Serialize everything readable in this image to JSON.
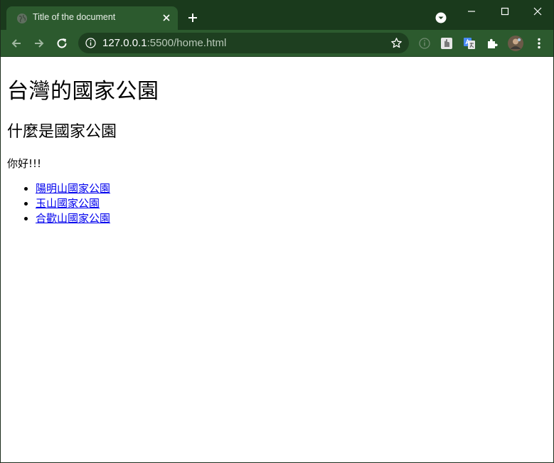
{
  "browser": {
    "tab": {
      "title": "Title of the document"
    },
    "address_bar": {
      "host": "127.0.0.1",
      "rest": ":5500/home.html"
    },
    "colors": {
      "frame": "#1a3a1c",
      "toolbar": "#2c5a2e",
      "omnibox": "#1e3f20",
      "link": "#0000ee"
    },
    "icons": {
      "tab_favicon": "globe-icon",
      "tab_close": "close-icon",
      "new_tab": "plus-icon",
      "tab_search": "chevron-down-circle-icon",
      "back": "arrow-left-icon",
      "forward": "arrow-right-icon",
      "reload": "reload-icon",
      "site_info": "info-icon",
      "bookmark": "star-icon",
      "extensions": "puzzle-icon",
      "menu": "kebab-menu-icon"
    }
  },
  "page": {
    "heading": "台灣的國家公園",
    "subheading": "什麼是國家公園",
    "paragraph": "你好!!!",
    "links": [
      {
        "label": "陽明山國家公園"
      },
      {
        "label": "玉山國家公園"
      },
      {
        "label": "合歡山國家公園"
      }
    ]
  }
}
